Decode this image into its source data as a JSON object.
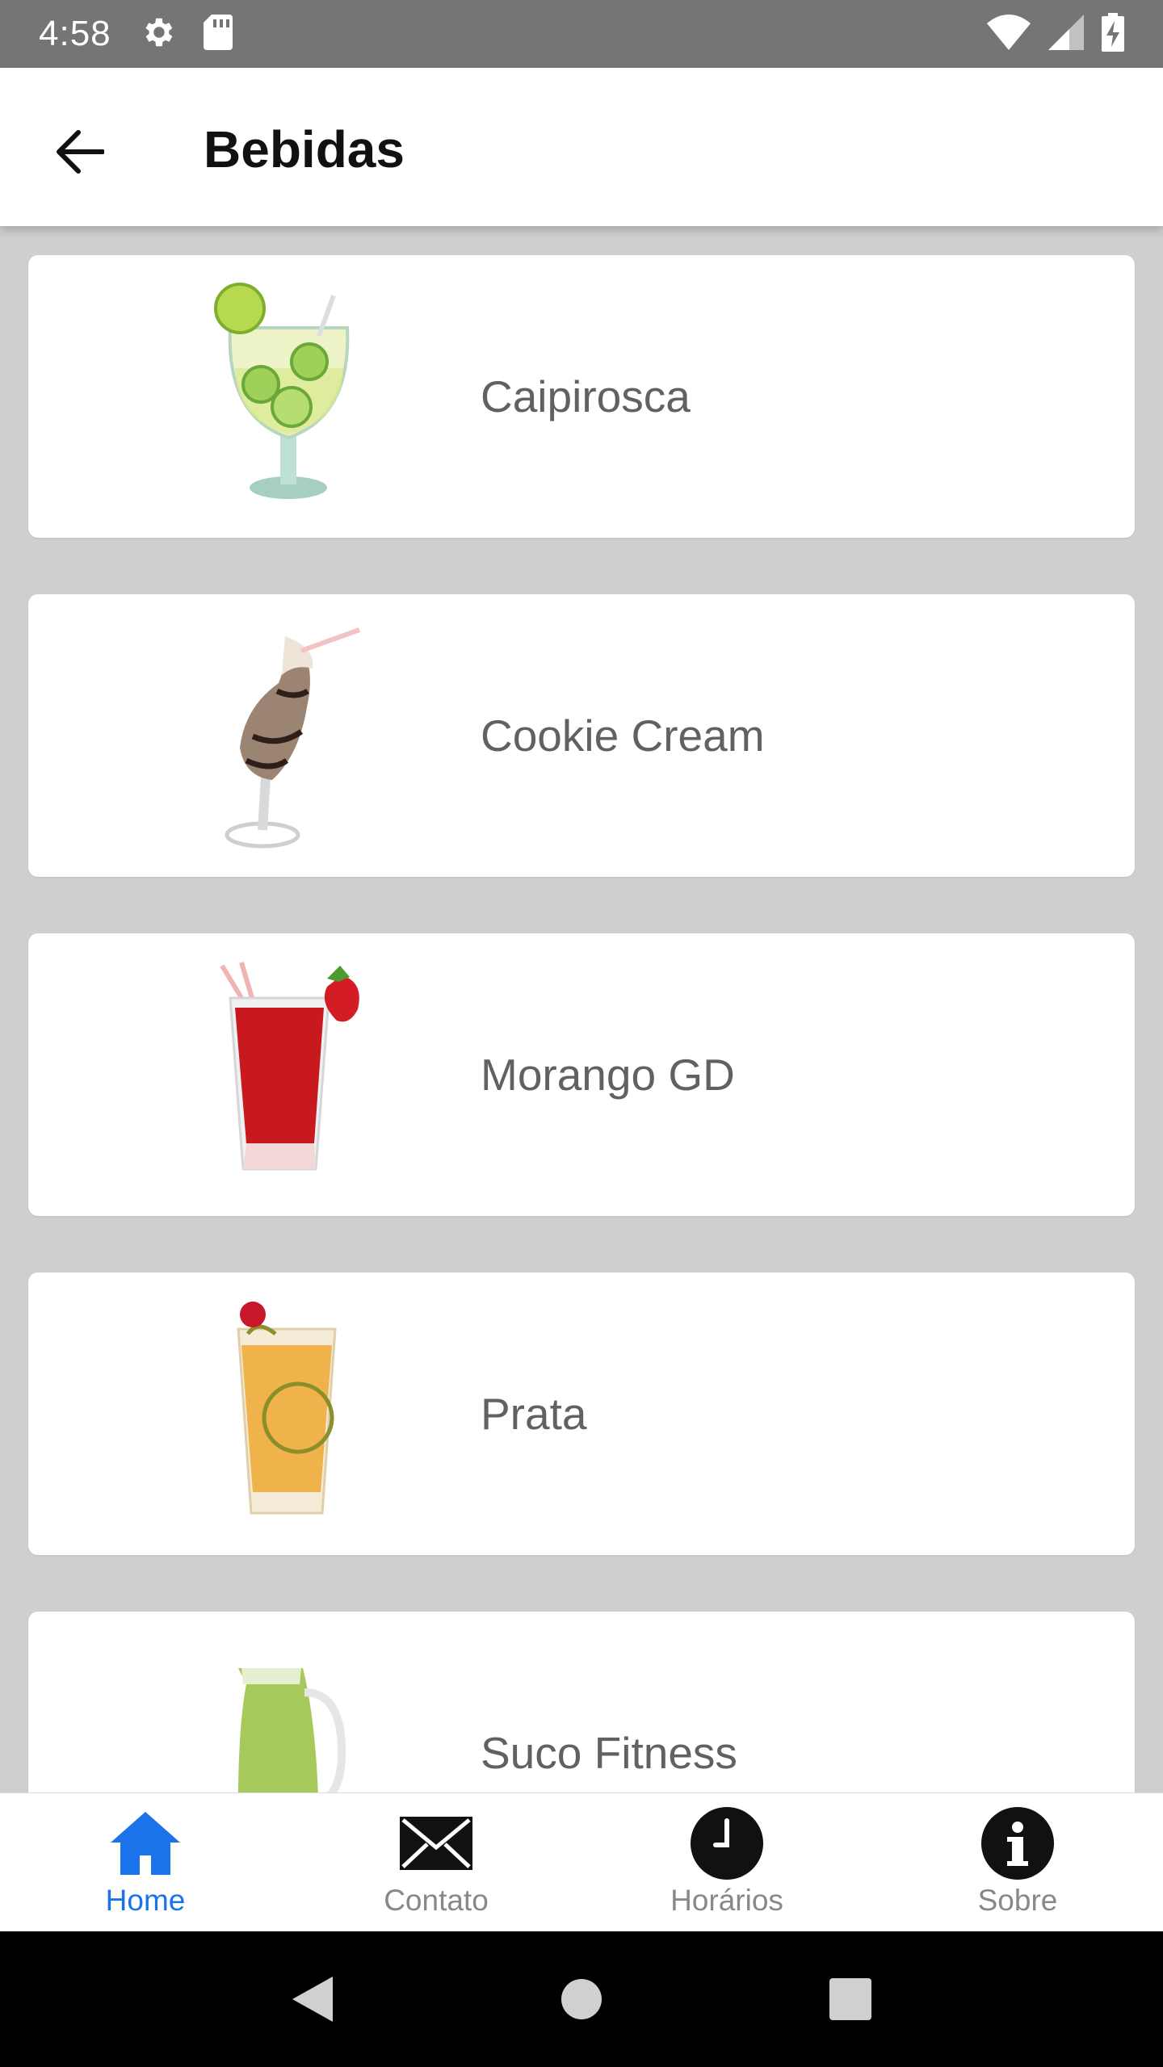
{
  "status_bar": {
    "time": "4:58",
    "icons": [
      "settings-gear-icon",
      "sd-card-icon",
      "wifi-icon",
      "cell-signal-icon",
      "battery-charging-icon"
    ]
  },
  "app_bar": {
    "title": "Bebidas",
    "back_icon": "arrow-left-icon"
  },
  "drinks": [
    {
      "name": "Caipirosca",
      "image": "caipirosca-drink-image"
    },
    {
      "name": "Cookie Cream",
      "image": "cookie-cream-drink-image"
    },
    {
      "name": "Morango GD",
      "image": "morango-drink-image"
    },
    {
      "name": "Prata",
      "image": "prata-drink-image"
    },
    {
      "name": "Suco Fitness",
      "image": "suco-fitness-drink-image"
    }
  ],
  "bottom_nav": {
    "active_color": "#1a73e8",
    "inactive_color": "#888888",
    "items": [
      {
        "label": "Home",
        "icon": "home-icon",
        "active": true
      },
      {
        "label": "Contato",
        "icon": "envelope-icon",
        "active": false
      },
      {
        "label": "Horários",
        "icon": "clock-icon",
        "active": false
      },
      {
        "label": "Sobre",
        "icon": "info-icon",
        "active": false
      }
    ]
  },
  "system_nav": {
    "buttons": [
      "back-triangle-icon",
      "home-circle-icon",
      "recents-square-icon"
    ]
  }
}
